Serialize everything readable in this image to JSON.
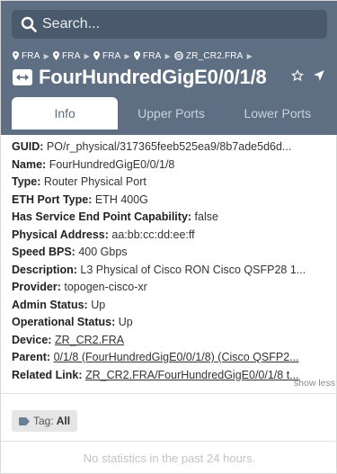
{
  "search": {
    "placeholder": "Search..."
  },
  "breadcrumbs": [
    {
      "label": "FRA",
      "icon": "location-pin-icon"
    },
    {
      "label": "FRA",
      "icon": "location-pin-icon"
    },
    {
      "label": "FRA",
      "icon": "location-pin-icon"
    },
    {
      "label": "FRA",
      "icon": "location-pin-icon"
    },
    {
      "label": "ZR_CR2.FRA",
      "icon": "router-icon"
    }
  ],
  "header": {
    "title": "FourHundredGigE0/0/1/8",
    "type_icon": "port-arrows-icon",
    "actions": [
      "star-icon",
      "locate-arrow-icon"
    ],
    "colors": {
      "header_bg": "#5e6f83",
      "search_bg": "#4a5a6c",
      "active_tab_text": "#5e6f83"
    }
  },
  "tabs": [
    {
      "label": "Info",
      "active": true
    },
    {
      "label": "Upper Ports",
      "active": false
    },
    {
      "label": "Lower Ports",
      "active": false
    }
  ],
  "properties": [
    {
      "key": "GUID:",
      "value": "PO/r_physical/317365feeb525ea9/8b7ade5d6d...",
      "link": false
    },
    {
      "key": "Name:",
      "value": "FourHundredGigE0/0/1/8",
      "link": false
    },
    {
      "key": "Type:",
      "value": "Router Physical Port",
      "link": false
    },
    {
      "key": "ETH Port Type:",
      "value": "ETH 400G",
      "link": false
    },
    {
      "key": "Has Service End Point Capability:",
      "value": "false",
      "link": false
    },
    {
      "key": "Physical Address:",
      "value": "aa:bb:cc:dd:ee:ff",
      "link": false
    },
    {
      "key": "Speed BPS:",
      "value": "400 Gbps",
      "link": false
    },
    {
      "key": "Description:",
      "value": "L3 Physical of Cisco RON Cisco QSFP28 1...",
      "link": false
    },
    {
      "key": "Provider:",
      "value": "topogen-cisco-xr",
      "link": false
    },
    {
      "key": "Admin Status:",
      "value": "Up",
      "link": false
    },
    {
      "key": "Operational Status:",
      "value": "Up",
      "link": false
    },
    {
      "key": "Device:",
      "value": "ZR_CR2.FRA",
      "link": true
    },
    {
      "key": "Parent:",
      "value": "0/1/8 (FourHundredGigE0/0/1/8) (Cisco QSFP2...",
      "link": true
    },
    {
      "key": "Related Link:",
      "value": "ZR_CR2.FRA/FourHundredGigE0/0/1/8 t...",
      "link": true
    }
  ],
  "show_less_label": "show less",
  "tag": {
    "icon": "tag-icon",
    "label": "Tag:",
    "value": "All"
  },
  "no_stats_text": "No statistics in the past 24 hours."
}
